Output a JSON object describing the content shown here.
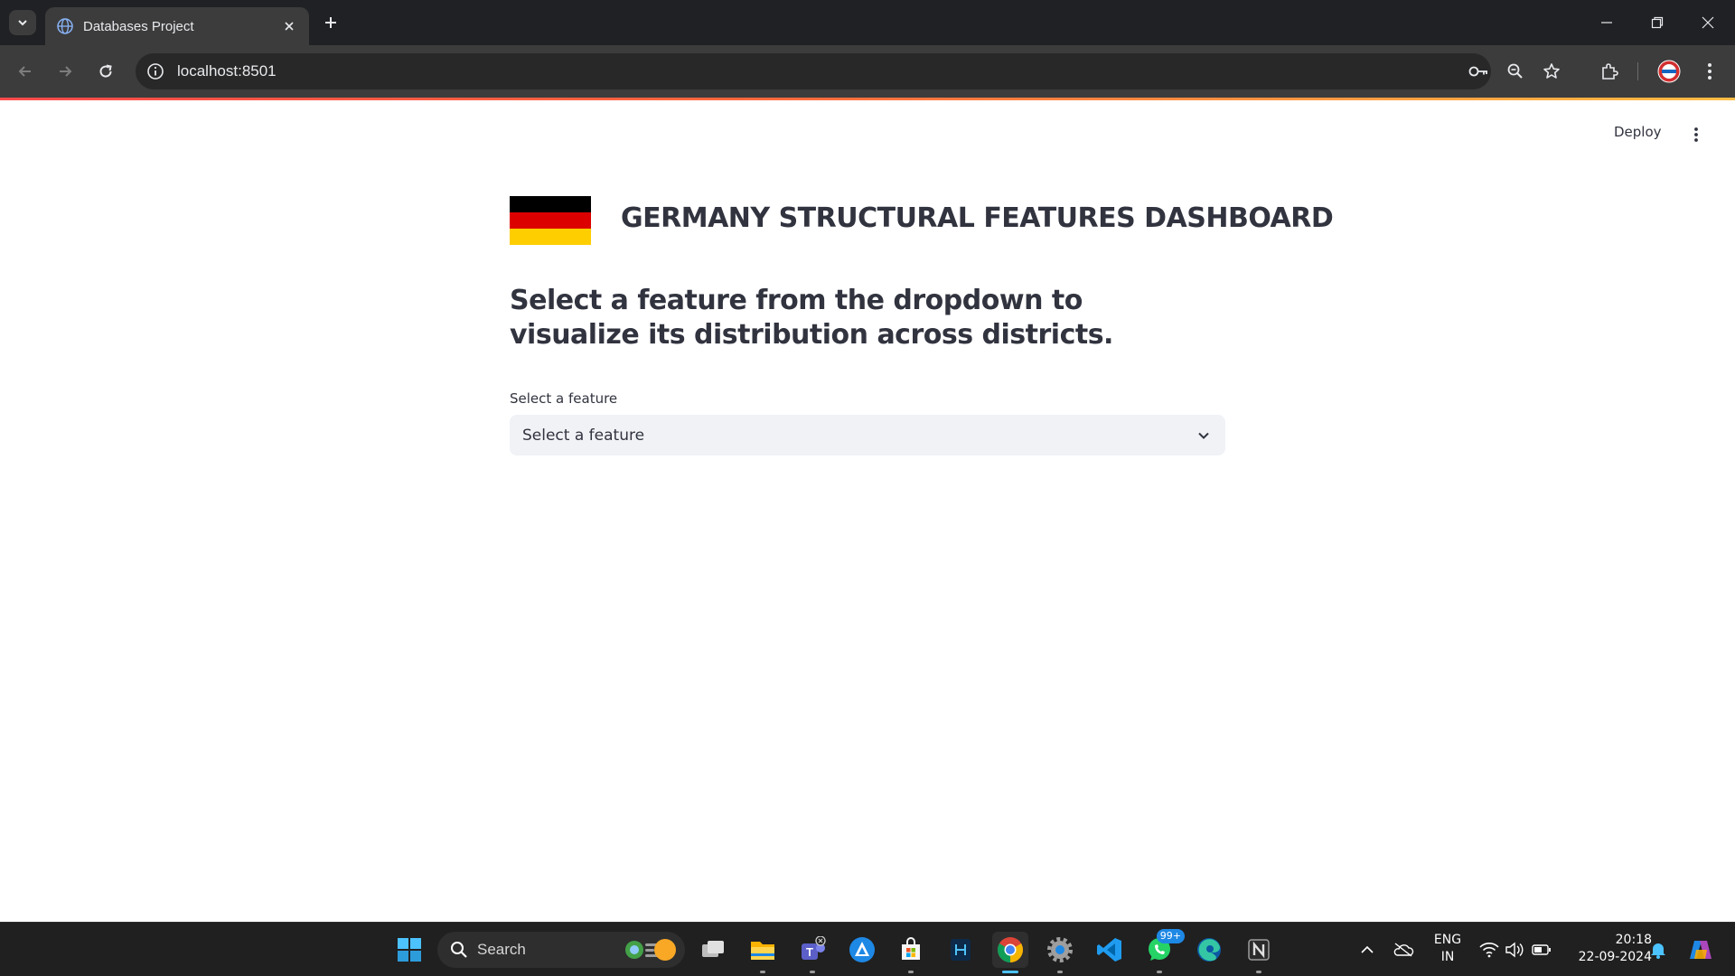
{
  "browser": {
    "tab_title": "Databases Project",
    "url": "localhost:8501"
  },
  "app": {
    "deploy_label": "Deploy",
    "title": "GERMANY STRUCTURAL FEATURES DASHBOARD",
    "subheading": "Select a feature from the dropdown to visualize its distribution across districts.",
    "select_label": "Select a feature",
    "select_value": "Select a feature",
    "flag_colors": [
      "#000000",
      "#dd0000",
      "#ffce00"
    ],
    "accent_color": "#ff4b4b"
  },
  "taskbar": {
    "search_label": "Search",
    "whatsapp_badge": "99+",
    "lang_line1": "ENG",
    "lang_line2": "IN",
    "time": "20:18",
    "date": "22-09-2024",
    "apps": [
      "start-icon",
      "widgets-icon",
      "task-view-icon",
      "file-explorer-icon",
      "teams-icon",
      "arc-icon",
      "store-icon",
      "sql-icon",
      "chrome-icon",
      "settings-icon",
      "vscode-icon",
      "whatsapp-icon",
      "edge-icon",
      "notion-icon"
    ]
  }
}
